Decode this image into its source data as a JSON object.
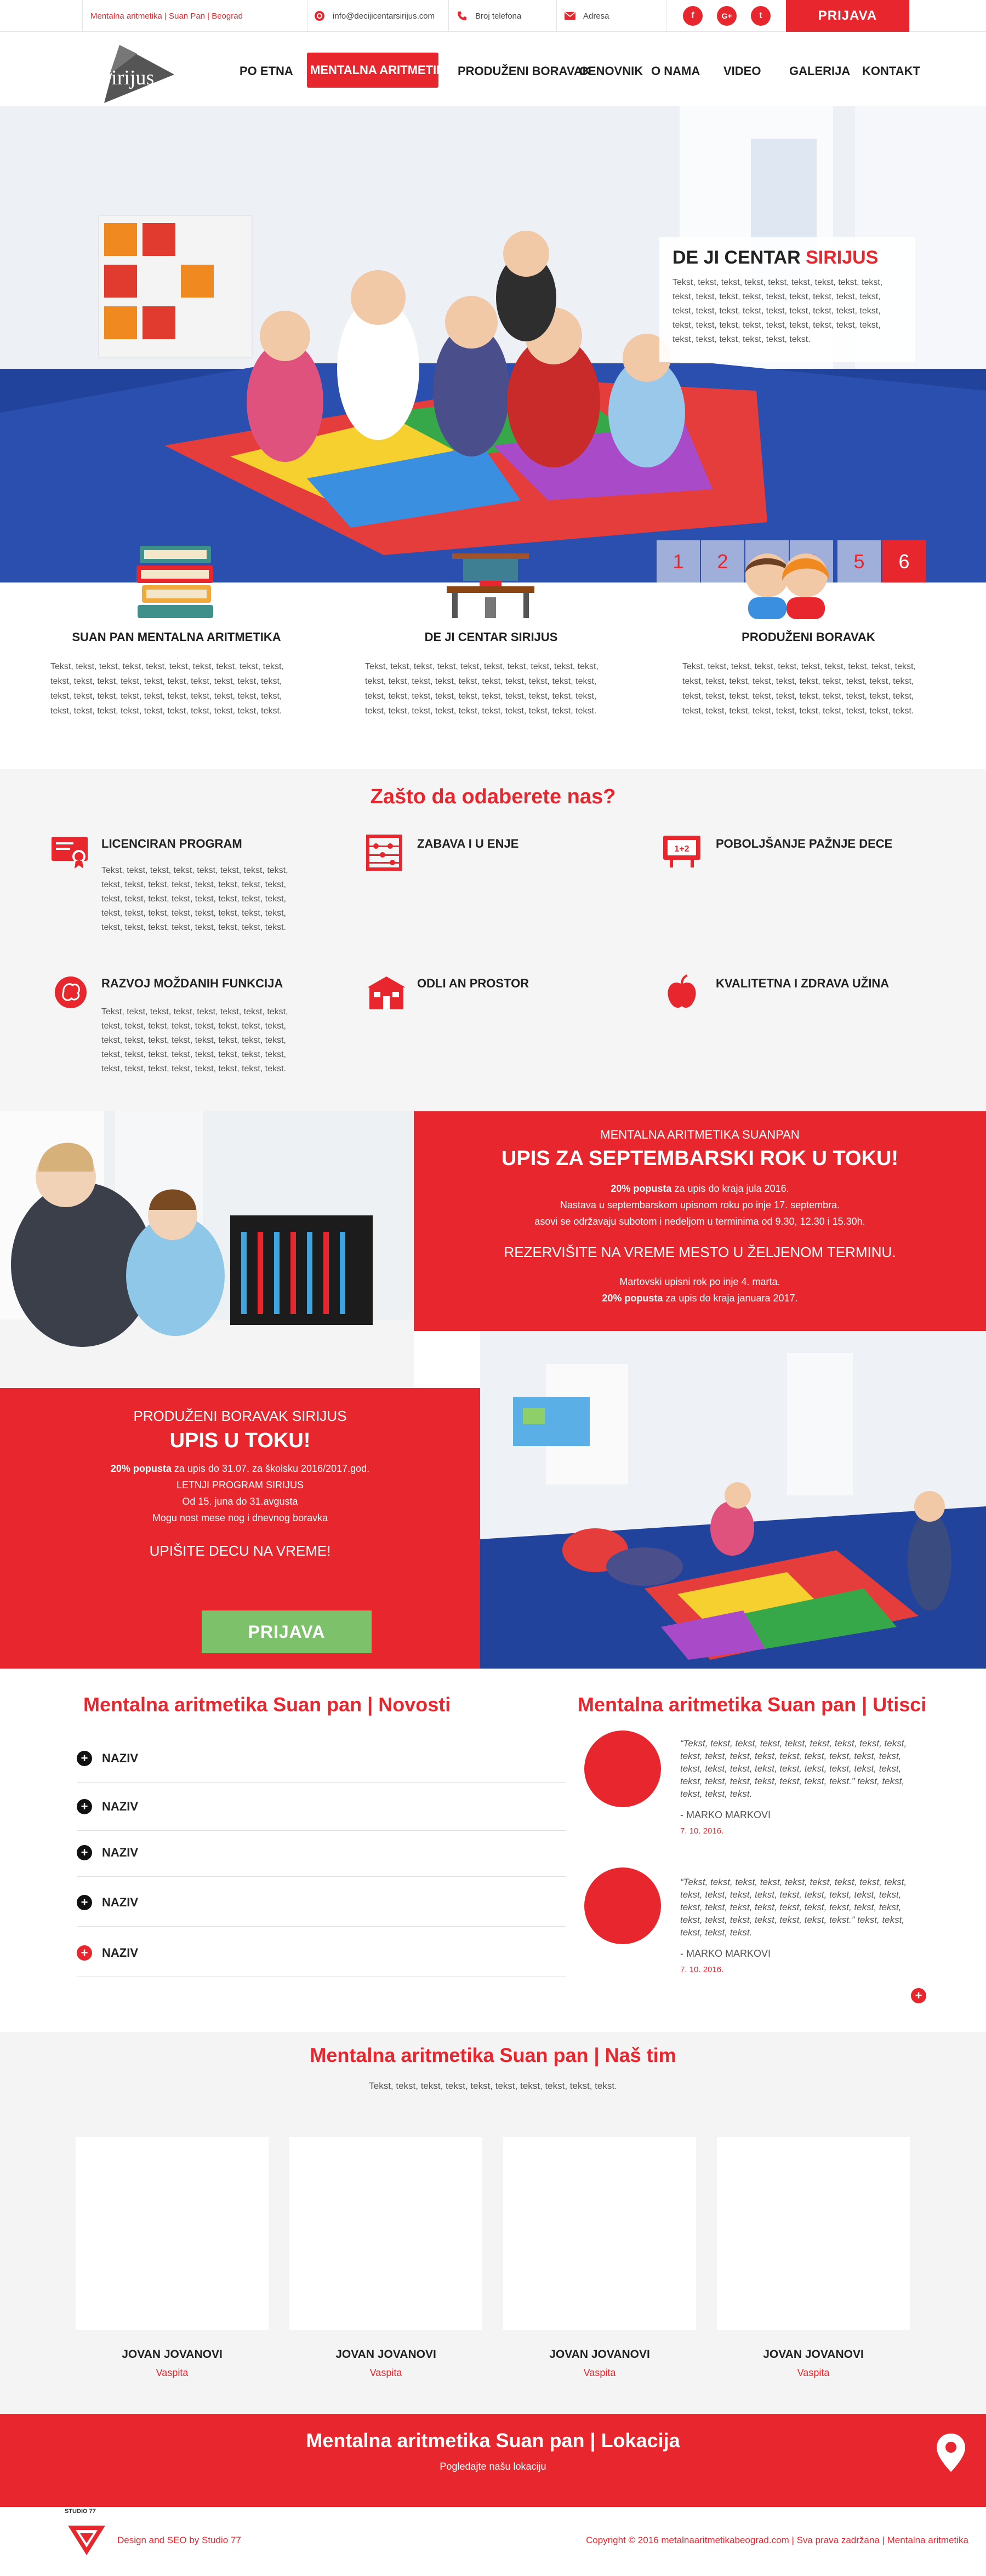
{
  "topbar": {
    "site_label": "Mentalna aritmetika | Suan Pan | Beograd",
    "email": "info@decijicentarsirijus.com",
    "phone": "Broj telefona",
    "address": "Adresa",
    "social": [
      "f",
      "G+",
      "t"
    ],
    "login": "PRIJAVA"
  },
  "logo": {
    "text": "Sirijus"
  },
  "nav": {
    "home": "PO ETNA",
    "active": "MENTALNA ARITMETIKA",
    "extended": "PRODUŽENI BORAVAK",
    "pricelist": "CENOVNIK",
    "about": "O NAMA",
    "video": "VIDEO",
    "gallery": "GALERIJA",
    "contact": "KONTAKT"
  },
  "hero": {
    "title_black": "DE JI CENTAR ",
    "title_red": "SIRIJUS",
    "text": "Tekst, tekst, tekst, tekst, tekst, tekst, tekst, tekst, tekst, tekst, tekst, tekst, tekst, tekst, tekst, tekst, tekst, tekst, tekst, tekst, tekst, tekst, tekst, tekst, tekst, tekst, tekst, tekst, tekst, tekst, tekst, tekst, tekst, tekst, tekst, tekst, tekst, tekst, tekst, tekst, tekst, tekst.",
    "pages": [
      "1",
      "2",
      "3",
      "4",
      "5",
      "6"
    ],
    "active_page": "6"
  },
  "features": [
    {
      "title": "SUAN PAN MENTALNA ARITMETIKA",
      "text": "Tekst, tekst, tekst, tekst, tekst, tekst, tekst, tekst, tekst, tekst, tekst, tekst, tekst, tekst, tekst, tekst, tekst, tekst, tekst, tekst, tekst, tekst, tekst, tekst, tekst, tekst, tekst, tekst, tekst, tekst, tekst, tekst, tekst, tekst, tekst, tekst, tekst, tekst, tekst, tekst."
    },
    {
      "title": "DE JI CENTAR SIRIJUS",
      "text": "Tekst, tekst, tekst, tekst, tekst, tekst, tekst, tekst, tekst, tekst, tekst, tekst, tekst, tekst, tekst, tekst, tekst, tekst, tekst, tekst, tekst, tekst, tekst, tekst, tekst, tekst, tekst, tekst, tekst, tekst, tekst, tekst, tekst, tekst, tekst, tekst, tekst, tekst, tekst, tekst."
    },
    {
      "title": "PRODUŽENI BORAVAK",
      "text": "Tekst, tekst, tekst, tekst, tekst, tekst, tekst, tekst, tekst, tekst, tekst, tekst, tekst, tekst, tekst, tekst, tekst, tekst, tekst, tekst, tekst, tekst, tekst, tekst, tekst, tekst, tekst, tekst, tekst, tekst, tekst, tekst, tekst, tekst, tekst, tekst, tekst, tekst, tekst, tekst."
    }
  ],
  "why": {
    "heading": "Zašto da odaberete nas?",
    "items": [
      {
        "title": "LICENCIRAN PROGRAM",
        "icon": "certificate-icon",
        "text": "Tekst, tekst, tekst, tekst, tekst, tekst, tekst, tekst, tekst, tekst, tekst, tekst, tekst, tekst, tekst, tekst, tekst, tekst, tekst, tekst, tekst, tekst, tekst, tekst, tekst, tekst, tekst, tekst, tekst, tekst, tekst, tekst, tekst, tekst, tekst, tekst, tekst, tekst, tekst, tekst."
      },
      {
        "title": "ZABAVA I U ENJE",
        "icon": "abacus-icon",
        "text": ""
      },
      {
        "title": "POBOLJŠANJE PAŽNJE DECE",
        "icon": "math-board-icon",
        "text": ""
      },
      {
        "title": "RAZVOJ MOŽDANIH FUNKCIJA",
        "icon": "brain-icon",
        "text": "Tekst, tekst, tekst, tekst, tekst, tekst, tekst, tekst, tekst, tekst, tekst, tekst, tekst, tekst, tekst, tekst, tekst, tekst, tekst, tekst, tekst, tekst, tekst, tekst, tekst, tekst, tekst, tekst, tekst, tekst, tekst, tekst, tekst, tekst, tekst, tekst, tekst, tekst, tekst, tekst."
      },
      {
        "title": "ODLI AN PROSTOR",
        "icon": "school-icon",
        "text": ""
      },
      {
        "title": "KVALITETNA I ZDRAVA UŽINA",
        "icon": "apple-icon",
        "text": ""
      }
    ]
  },
  "promo1": {
    "kicker": "MENTALNA ARITMETIKA SUANPAN",
    "title": "UPIS ZA SEPTEMBARSKI ROK U TOKU!",
    "line1_bold": "20% popusta",
    "line1_rest": " za upis do kraja jula 2016.",
    "line2": "Nastava u septembarskom upisnom roku po inje 17. septembra.",
    "line3": "asovi se održavaju subotom i nedeljom u terminima od 9.30, 12.30 i 15.30h.",
    "cta": "REZERVIŠITE NA VREME MESTO U ŽELJENOM TERMINU.",
    "line4": "Martovski upisni rok po inje 4. marta.",
    "line5_bold": "20% popusta",
    "line5_rest": " za upis do kraja januara 2017."
  },
  "promo2": {
    "kicker": "PRODUŽENI BORAVAK SIRIJUS",
    "title": "UPIS U TOKU!",
    "line1_bold": "20% popusta",
    "line1_rest": " za upis do 31.07. za školsku 2016/2017.god.",
    "line2": "LETNJI PROGRAM SIRIJUS",
    "line3": "Od 15. juna do 31.avgusta",
    "line4": "Mogu nost mese nog i dnevnog boravka",
    "cta": "UPIŠITE DECU NA VREME!",
    "button": "PRIJAVA"
  },
  "news": {
    "heading": "Mentalna aritmetika Suan pan | Novosti",
    "items": [
      "NAZIV",
      "NAZIV",
      "NAZIV",
      "NAZIV",
      "NAZIV"
    ]
  },
  "testimonials": {
    "heading": "Mentalna aritmetika Suan pan | Utisci",
    "items": [
      {
        "quote": "“Tekst, tekst, tekst, tekst, tekst, tekst, tekst, tekst, tekst, tekst, tekst, tekst, tekst, tekst, tekst, tekst, tekst, tekst, tekst, tekst, tekst, tekst, tekst, tekst, tekst, tekst, tekst, tekst, tekst, tekst, tekst, tekst, tekst, tekst.” tekst, tekst, tekst, tekst, tekst.",
        "author": "- MARKO MARKOVI",
        "date": "7. 10. 2016."
      },
      {
        "quote": "“Tekst, tekst, tekst, tekst, tekst, tekst, tekst, tekst, tekst, tekst, tekst, tekst, tekst, tekst, tekst, tekst, tekst, tekst, tekst, tekst, tekst, tekst, tekst, tekst, tekst, tekst, tekst, tekst, tekst, tekst, tekst, tekst, tekst, tekst.” tekst, tekst, tekst, tekst, tekst.",
        "author": "- MARKO MARKOVI",
        "date": "7. 10. 2016."
      }
    ]
  },
  "team": {
    "heading": "Mentalna aritmetika Suan pan | Naš tim",
    "subtitle": "Tekst, tekst, tekst, tekst, tekst, tekst, tekst, tekst, tekst, tekst.",
    "members": [
      {
        "name": "JOVAN JOVANOVI",
        "role": "Vaspita"
      },
      {
        "name": "JOVAN JOVANOVI",
        "role": "Vaspita"
      },
      {
        "name": "JOVAN JOVANOVI",
        "role": "Vaspita"
      },
      {
        "name": "JOVAN JOVANOVI",
        "role": "Vaspita"
      }
    ]
  },
  "location": {
    "heading": "Mentalna aritmetika Suan pan | Lokacija",
    "subtitle": "Pogledajte našu lokaciju"
  },
  "footer": {
    "studio_logo": "STUDIO 77",
    "credit": "Design and SEO by Studio 77",
    "copyright": "Copyright © 2016 metalnaaritmetikabeograd.com | Sva prava zadržana | Mentalna aritmetika"
  },
  "colors": {
    "accent": "#e8262d",
    "button_green": "#7dc26b",
    "light_bg": "#f5f5f5"
  }
}
